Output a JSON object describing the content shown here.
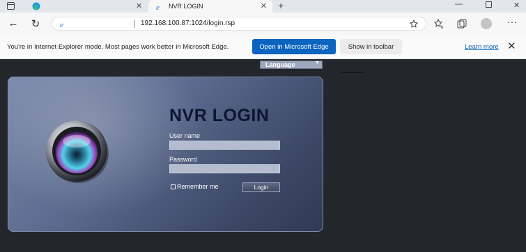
{
  "browser": {
    "tab": {
      "title": "NVR LOGIN"
    },
    "address": {
      "url": "192.168.100.87:1024/login.rsp"
    }
  },
  "ie_banner": {
    "message": "You're in Internet Explorer mode. Most pages work better in Microsoft Edge.",
    "open_edge_label": "Open in Microsoft Edge",
    "show_toolbar_label": "Show in toolbar",
    "learn_more_label": "Learn more"
  },
  "page": {
    "language_label": "Language",
    "title": "NVR LOGIN",
    "username_label": "User name",
    "password_label": "Password",
    "remember_label": "Remember me",
    "login_label": "Login"
  },
  "colors": {
    "accent": "#0b64c0",
    "panel": "#5c6b8f",
    "page_bg": "#23262b"
  }
}
